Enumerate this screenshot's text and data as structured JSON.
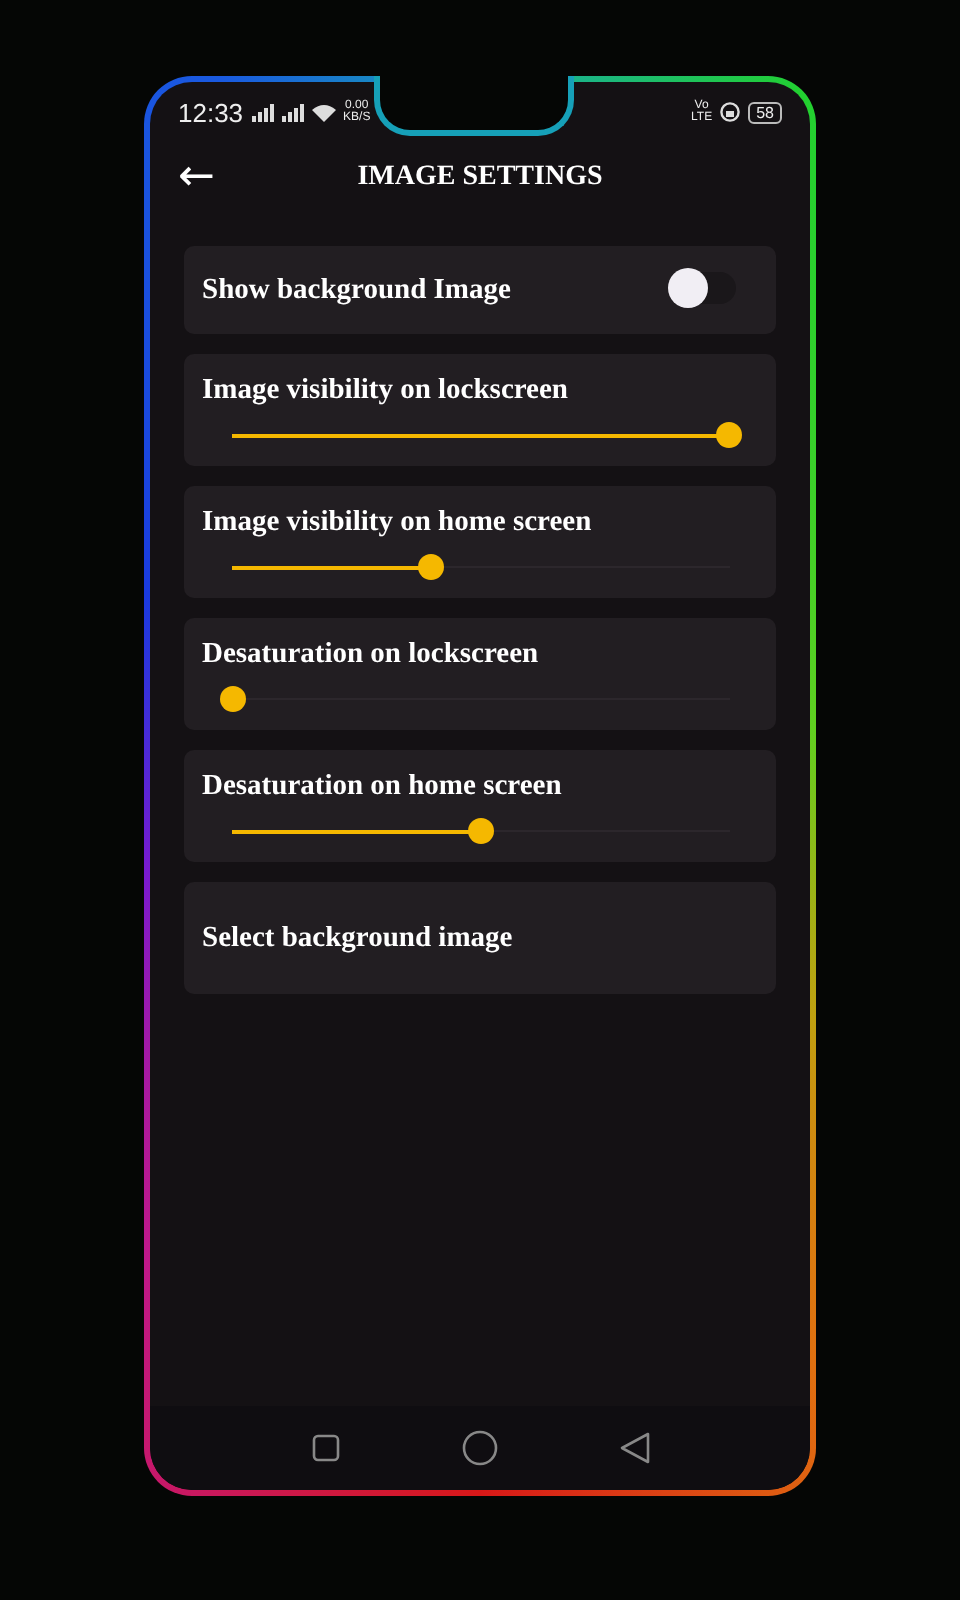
{
  "status_bar": {
    "time": "12:33",
    "speed_value": "0.00",
    "speed_unit": "KB/S",
    "volte_top": "Vo",
    "volte_bottom": "LTE",
    "battery": "58"
  },
  "header": {
    "back": "←",
    "title": "IMAGE SETTINGS"
  },
  "settings": [
    {
      "kind": "toggle",
      "label": "Show background Image",
      "on": false
    },
    {
      "kind": "slider",
      "label": "Image visibility on lockscreen",
      "level": 1.0
    },
    {
      "kind": "slider",
      "label": "Image visibility on home screen",
      "level": 0.4
    },
    {
      "kind": "slider",
      "label": "Desaturation on lockscreen",
      "level": 0.0
    },
    {
      "kind": "slider",
      "label": "Desaturation on home screen",
      "level": 0.5
    },
    {
      "kind": "action",
      "label": "Select background image"
    }
  ]
}
